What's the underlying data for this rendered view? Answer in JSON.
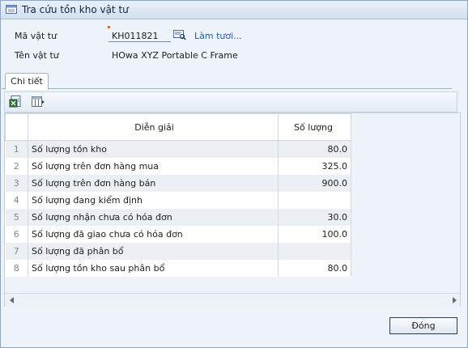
{
  "window": {
    "title": "Tra cứu tồn kho vật tư"
  },
  "form": {
    "code_label": "Mã vật tư",
    "code_value": "KH011821",
    "refresh_label": "Làm tươi...",
    "name_label": "Tên vật tư",
    "name_value": "HOwa XYZ Portable C Frame"
  },
  "tabs": [
    {
      "label": "Chi tiết"
    }
  ],
  "toolbar": {
    "icons": [
      "export-excel-icon",
      "column-chooser-icon"
    ]
  },
  "grid": {
    "columns": [
      "Diễn giải",
      "Số lượng"
    ],
    "rows": [
      {
        "no": "1",
        "desc": "Số lượng tồn kho",
        "qty": "80.0"
      },
      {
        "no": "2",
        "desc": "Số lượng trên đơn hàng mua",
        "qty": "325.0"
      },
      {
        "no": "3",
        "desc": "Số lượng trên đơn hàng bán",
        "qty": "900.0"
      },
      {
        "no": "4",
        "desc": "Số lượng đang kiểm định",
        "qty": ""
      },
      {
        "no": "5",
        "desc": "Số lượng nhận chưa có hóa đơn",
        "qty": "30.0"
      },
      {
        "no": "6",
        "desc": "Số lượng đã giao chưa có hóa đơn",
        "qty": "100.0"
      },
      {
        "no": "7",
        "desc": "Số lượng đã phân bổ",
        "qty": ""
      },
      {
        "no": "8",
        "desc": "Số lượng tồn kho sau phân bổ",
        "qty": "80.0"
      }
    ]
  },
  "footer": {
    "close_label": "Đóng"
  },
  "colors": {
    "title_bar": "#d3e0f0",
    "link": "#1f5fa8",
    "alt_row": "#eceff3",
    "window_bg": "#eef3f9"
  }
}
